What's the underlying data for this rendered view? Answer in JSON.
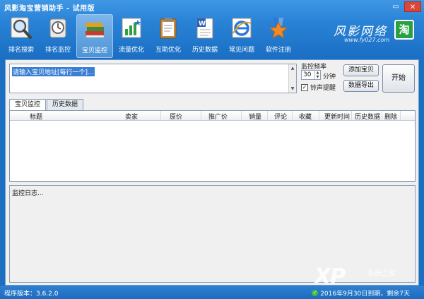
{
  "window": {
    "title": "风影淘宝营销助手 - 试用版",
    "minimize_glyph": "▭",
    "close_glyph": "✕"
  },
  "toolbar": {
    "items": [
      {
        "label": "排名搜索",
        "icon": "magnifier-icon"
      },
      {
        "label": "排名监控",
        "icon": "clock-icon"
      },
      {
        "label": "宝贝监控",
        "icon": "books-icon",
        "active": true
      },
      {
        "label": "流量优化",
        "icon": "bar-chart-icon"
      },
      {
        "label": "互助优化",
        "icon": "clipboard-icon"
      },
      {
        "label": "历史数据",
        "icon": "document-icon"
      },
      {
        "label": "常见问题",
        "icon": "ie-icon"
      },
      {
        "label": "软件注册",
        "icon": "star-badge-icon"
      }
    ]
  },
  "brand": {
    "name": "风影网络",
    "url": "www.fy027.com",
    "badge": "淘"
  },
  "monitor": {
    "url_placeholder": "请输入宝贝地址[每行一个]...",
    "frequency_label": "监控频率",
    "frequency_value": "30",
    "frequency_unit": "分钟",
    "bell_label": "铃声提醒",
    "bell_checked": true,
    "add_label": "添加宝贝",
    "export_label": "数据导出",
    "start_label": "开始"
  },
  "tabs": [
    {
      "label": "宝贝监控",
      "active": true
    },
    {
      "label": "历史数据",
      "active": false
    }
  ],
  "table": {
    "columns": [
      "标题",
      "卖家",
      "原价",
      "推广价",
      "销量",
      "评论",
      "收藏",
      "更新时间",
      "历史数据",
      "删除"
    ]
  },
  "log": {
    "text": "监控日志..."
  },
  "status": {
    "version": "程序版本：3.6.2.0",
    "expiry": "2016年9月30日到期，剩余7天"
  },
  "watermark": {
    "logo": "XP",
    "sub": "系统之家"
  },
  "colors": {
    "header_blue": "#2a83d6",
    "accent_green": "#2aa045",
    "close_red": "#d9463a"
  }
}
